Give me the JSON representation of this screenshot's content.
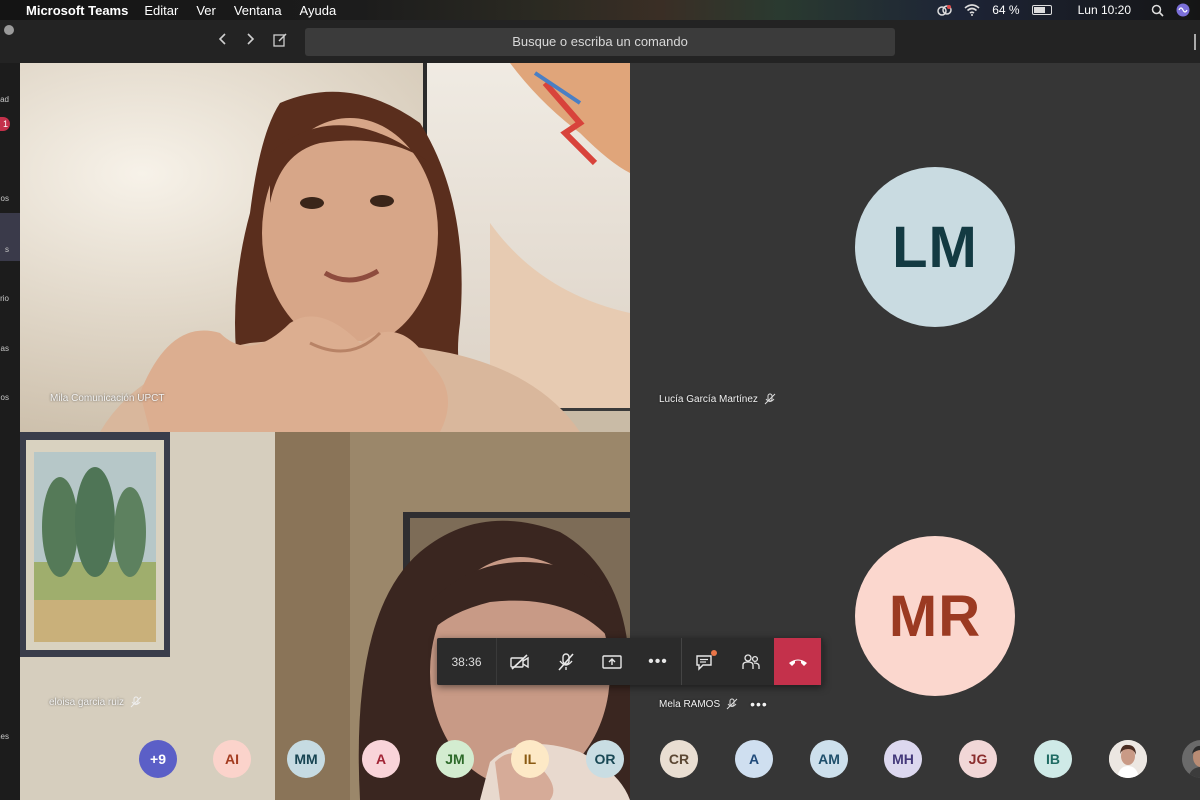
{
  "menubar": {
    "app": "Microsoft Teams",
    "items": [
      "Editar",
      "Ver",
      "Ventana",
      "Ayuda"
    ],
    "battery": "64 %",
    "clock": "Lun 10:20"
  },
  "titlebar": {
    "search_placeholder": "Busque o escriba un comando"
  },
  "rail": {
    "labels": [
      "ad",
      "os",
      "s",
      "rio",
      "as",
      "os",
      "ones"
    ],
    "badge": "1"
  },
  "tiles": [
    {
      "name": "Mila Comunicación UPCT",
      "type": "video"
    },
    {
      "name": "Lucía García Martínez",
      "type": "avatar",
      "initials": "LM",
      "bg": "#c9dbe1",
      "fg": "#133a42",
      "muted": true
    },
    {
      "name": "eloisa garcia ruiz",
      "type": "video",
      "muted": true
    },
    {
      "name": "Mela RAMOS",
      "type": "avatar",
      "initials": "MR",
      "bg": "#fbd7ce",
      "fg": "#9b3a22",
      "muted": true
    }
  ],
  "controls": {
    "timer": "38:36",
    "accent": "#c4314b"
  },
  "participants": [
    {
      "initials": "+9",
      "bg": "#5b5fc7",
      "fg": "#ffffff"
    },
    {
      "initials": "AI",
      "bg": "#fbd3cb",
      "fg": "#a33b1f"
    },
    {
      "initials": "MM",
      "bg": "#c6dbe2",
      "fg": "#174452"
    },
    {
      "initials": "A",
      "bg": "#f9d4d9",
      "fg": "#a12435"
    },
    {
      "initials": "JM",
      "bg": "#d3ecd0",
      "fg": "#2d6a2a"
    },
    {
      "initials": "IL",
      "bg": "#fde9c6",
      "fg": "#8a5a12"
    },
    {
      "initials": "OR",
      "bg": "#c9dde3",
      "fg": "#194855"
    },
    {
      "initials": "CR",
      "bg": "#e9ded2",
      "fg": "#5b4733"
    },
    {
      "initials": "A",
      "bg": "#cfdff0",
      "fg": "#1f4a7a"
    },
    {
      "initials": "AM",
      "bg": "#cde0ec",
      "fg": "#1e4f6b"
    },
    {
      "initials": "MH",
      "bg": "#dcd8ef",
      "fg": "#43387a"
    },
    {
      "initials": "JG",
      "bg": "#f1d7d7",
      "fg": "#8a2d2d"
    },
    {
      "initials": "IB",
      "bg": "#cfeae7",
      "fg": "#1f6b63"
    }
  ]
}
